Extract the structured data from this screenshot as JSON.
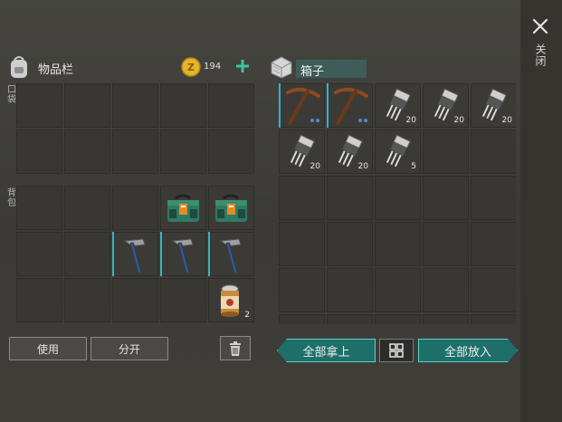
{
  "close": {
    "label": "关闭"
  },
  "inventory": {
    "title": "物品栏",
    "coins": "194",
    "pockets_label": "口袋",
    "backpack_label": "背包",
    "use_label": "使用",
    "split_label": "分开"
  },
  "box": {
    "title": "箱子",
    "take_all_label": "全部拿上",
    "put_all_label": "全部放入",
    "slots": [
      {
        "item": "pickaxe",
        "count": "",
        "durability_dots": 2
      },
      {
        "item": "pickaxe",
        "count": "",
        "durability_dots": 2
      },
      {
        "item": "transistor",
        "count": "20"
      },
      {
        "item": "transistor",
        "count": "20"
      },
      {
        "item": "transistor",
        "count": "20"
      },
      {
        "item": "transistor",
        "count": "20"
      },
      {
        "item": "transistor",
        "count": "20"
      },
      {
        "item": "transistor",
        "count": "5"
      }
    ]
  },
  "backpack_items": [
    {
      "item": "toolbox",
      "count": ""
    },
    {
      "item": "toolbox",
      "count": ""
    },
    {
      "item": "hammer",
      "count": ""
    },
    {
      "item": "hammer",
      "count": ""
    },
    {
      "item": "hammer",
      "count": ""
    },
    {
      "item": "canned-food",
      "count": "2"
    }
  ],
  "colors": {
    "accent_teal": "#2fb7c2",
    "button_teal": "#1e6f6a",
    "coin_gold": "#e3b52a",
    "plus_green": "#3fc2a0"
  }
}
